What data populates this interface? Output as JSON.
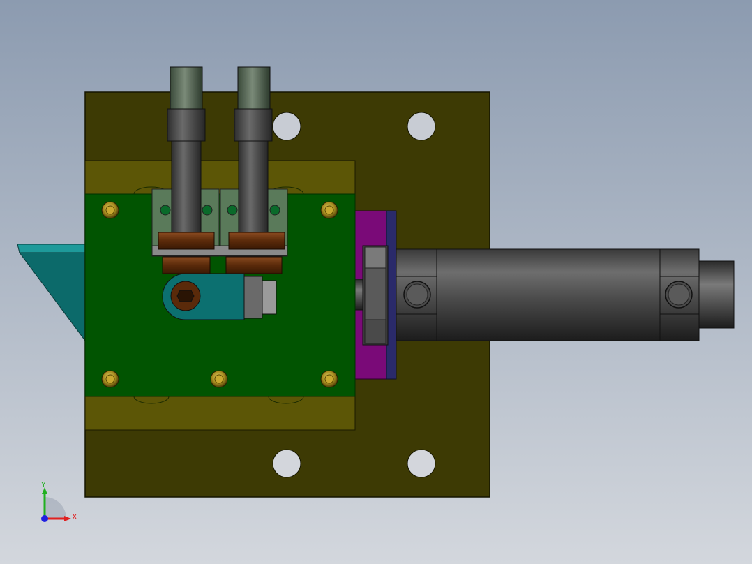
{
  "viewport": {
    "background_top": "#8c9bb0",
    "background_bottom": "#d2d6dc"
  },
  "colors": {
    "base_plate": "#3d3a04",
    "base_plate_edge": "#1a1a00",
    "mount_plate": "#5a5508",
    "green_plate": "#015401",
    "flange": "#7a0a78",
    "cylinder_dark": "#2a2a2a",
    "cylinder_light": "#6a6a6a",
    "bracket": "#0c7070",
    "nut_brown": "#6a2e0c",
    "bolt_gold": "#b59a26",
    "axis_x": "#e02020",
    "axis_y": "#20b020",
    "axis_z": "#2020e0"
  },
  "triad": {
    "x_label": "X",
    "y_label": "Y"
  }
}
